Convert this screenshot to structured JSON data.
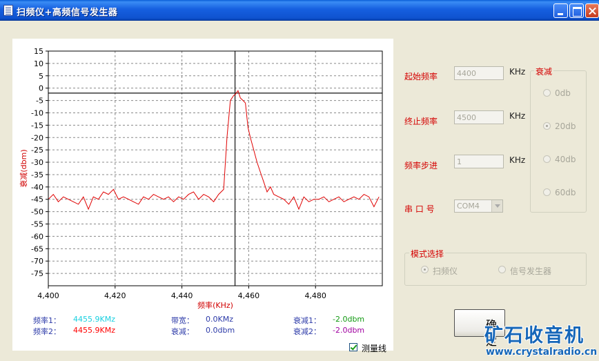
{
  "window": {
    "title": "扫频仪+高频信号发生器"
  },
  "chart_data": {
    "type": "line",
    "xlabel": "频率(KHz)",
    "ylabel": "衰减(dbm)",
    "xlim": [
      4400,
      4500
    ],
    "ylim": [
      -80,
      15
    ],
    "x_ticks": [
      4400,
      4420,
      4440,
      4460,
      4480
    ],
    "x_tick_labels": [
      "4,400",
      "4,420",
      "4,440",
      "4,460",
      "4,480"
    ],
    "y_ticks": [
      15,
      10,
      5,
      0,
      -5,
      -10,
      -15,
      -20,
      -25,
      -30,
      -35,
      -40,
      -45,
      -50,
      -55,
      -60,
      -65,
      -70,
      -75
    ],
    "grid": true,
    "cursor_x": 4455.9,
    "reference_y": -2,
    "series": [
      {
        "color": "#e00000",
        "x": [
          4400.0,
          4401.5,
          4403.0,
          4404.5,
          4406.0,
          4407.5,
          4409.0,
          4410.5,
          4412.0,
          4413.5,
          4415.0,
          4416.5,
          4418.0,
          4419.5,
          4421.0,
          4422.5,
          4424.0,
          4425.5,
          4427.0,
          4428.5,
          4430.0,
          4431.5,
          4433.0,
          4434.5,
          4436.0,
          4437.5,
          4439.0,
          4440.5,
          4442.0,
          4443.5,
          4445.0,
          4446.5,
          4448.0,
          4449.5,
          4451.0,
          4452.5,
          4453.5,
          4454.5,
          4455.5,
          4456.0,
          4456.8,
          4457.5,
          4458.3,
          4459.0,
          4459.8,
          4460.5,
          4461.5,
          4462.5,
          4463.5,
          4464.5,
          4465.5,
          4466.5,
          4467.5,
          4469.0,
          4470.5,
          4472.0,
          4473.5,
          4475.0,
          4476.5,
          4478.0,
          4479.5,
          4481.0,
          4482.5,
          4484.0,
          4485.5,
          4487.0,
          4488.5,
          4490.0,
          4491.5,
          4493.0,
          4494.5,
          4496.0,
          4497.5,
          4499.0
        ],
        "y": [
          -45,
          -43,
          -46,
          -44,
          -45,
          -46,
          -47,
          -44,
          -49,
          -44,
          -45,
          -42,
          -43,
          -41,
          -45,
          -44,
          -45,
          -46,
          -47,
          -44,
          -45,
          -43,
          -44,
          -45,
          -44,
          -46,
          -44,
          -45,
          -43,
          -42,
          -45,
          -43,
          -44,
          -46,
          -43,
          -41,
          -20,
          -5,
          -3,
          -2.5,
          -1,
          -4,
          -5,
          -6,
          -16,
          -20,
          -25,
          -30,
          -34,
          -38,
          -42,
          -40,
          -43,
          -44,
          -45,
          -47,
          -44,
          -49,
          -44,
          -46,
          -45,
          -45,
          -44,
          -46,
          -45,
          -44,
          -46,
          -45,
          -44,
          -45,
          -43,
          -44,
          -48,
          -44
        ]
      }
    ]
  },
  "readouts": {
    "freq1_label": "频率1：",
    "freq1_value": "4455.9KMz",
    "freq2_label": "频率2：",
    "freq2_value": "4455.9KMz",
    "bandwidth_label": "带宽：",
    "bandwidth_value": "0.0KMz",
    "atten_label": "衰减：",
    "atten_value": "0.0dbm",
    "atten1_label": "衰减1：",
    "atten1_value": "-2.0dbm",
    "atten2_label": "衰减2：",
    "atten2_value": "-2.0dbm"
  },
  "measure_line": {
    "label": "测量线",
    "checked": true
  },
  "settings": {
    "start_freq_label": "起始频率",
    "start_freq_value": "4400",
    "stop_freq_label": "终止频率",
    "stop_freq_value": "4500",
    "step_label": "频率步进",
    "step_value": "1",
    "unit": "KHz",
    "port_label": "串  口  号",
    "port_value": "COM4"
  },
  "attenuation_group": {
    "title": "衰减",
    "options": [
      "0db",
      "20db",
      "40db",
      "60db"
    ],
    "selected": "20db"
  },
  "mode_group": {
    "title": "模式选择",
    "options": [
      "扫频仪",
      "信号发生器"
    ],
    "selected": "扫频仪"
  },
  "ok_button": {
    "label": "确 定"
  },
  "watermark": {
    "text": "矿石收音机",
    "url": "www.crystalradio.cn"
  }
}
